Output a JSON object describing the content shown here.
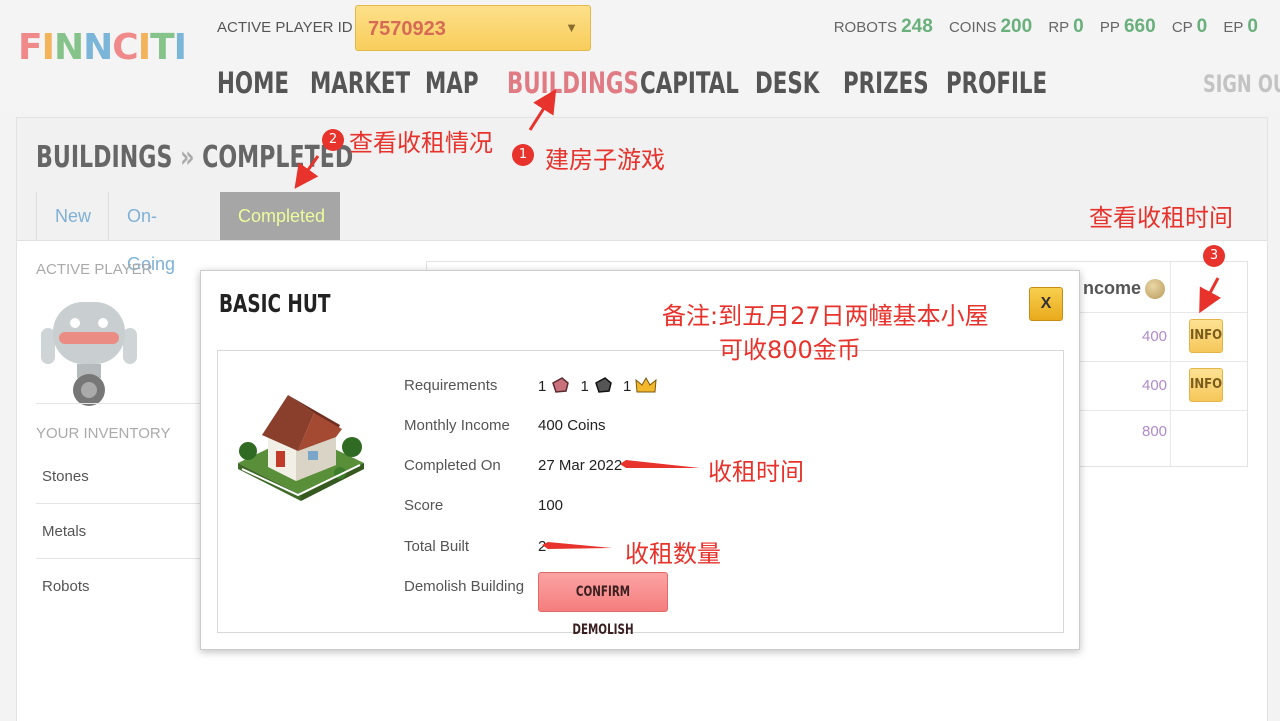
{
  "header": {
    "logo_text": "FINNCITI",
    "player_id_label": "ACTIVE PLAYER ID",
    "player_id_value": "7570923",
    "stats": [
      {
        "label": "ROBOTS",
        "value": "248"
      },
      {
        "label": "COINS",
        "value": "200"
      },
      {
        "label": "RP",
        "value": "0"
      },
      {
        "label": "PP",
        "value": "660"
      },
      {
        "label": "CP",
        "value": "0"
      },
      {
        "label": "EP",
        "value": "0"
      }
    ],
    "nav": [
      "HOME",
      "MARKET",
      "MAP",
      "BUILDINGS",
      "CAPITAL",
      "DESK",
      "PRIZES",
      "PROFILE"
    ],
    "active_nav": "BUILDINGS",
    "sign_out": "SIGN OUT",
    "accent_color": "#e07a83",
    "stat_color": "#6ab07c"
  },
  "page": {
    "breadcrumb_root": "BUILDINGS",
    "breadcrumb_sep": "»",
    "breadcrumb_current": "COMPLETED",
    "tabs": [
      "New",
      "On-Going",
      "Completed"
    ],
    "selected_tab": "Completed"
  },
  "sidebar": {
    "active_player_label": "ACTIVE PLAYER",
    "inventory_label": "YOUR INVENTORY",
    "inventory_items": [
      "Stones",
      "Metals",
      "Robots"
    ]
  },
  "table": {
    "income_header": "ncome",
    "rows": [
      {
        "income": "400",
        "action": "INFO"
      },
      {
        "income": "400",
        "action": "INFO"
      },
      {
        "income": "800",
        "action": ""
      }
    ]
  },
  "modal": {
    "title": "BASIC HUT",
    "close_label": "X",
    "fields": {
      "requirements_label": "Requirements",
      "requirements": [
        "1",
        "1",
        "1"
      ],
      "monthly_income_label": "Monthly Income",
      "monthly_income": "400 Coins",
      "completed_on_label": "Completed On",
      "completed_on": "27 Mar 2022",
      "score_label": "Score",
      "score": "100",
      "total_built_label": "Total Built",
      "total_built": "2",
      "demolish_label": "Demolish Building",
      "demolish_button": "CONFIRM DEMOLISH"
    }
  },
  "annotations": {
    "a1_num": "1",
    "a1_text": "建房子游戏",
    "a2_num": "2",
    "a2_text": "查看收租情况",
    "a3_num": "3",
    "a3_text": "查看收租时间",
    "note_line1": "备注:到五月27日两幢基本小屋",
    "note_line2": "可收800金币",
    "rent_time": "收租时间",
    "rent_count": "收租数量",
    "color": "#e8322c"
  }
}
